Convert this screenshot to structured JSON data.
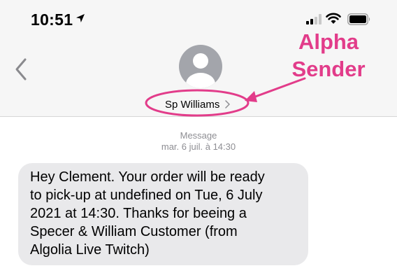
{
  "status_bar": {
    "time": "10:51"
  },
  "header": {
    "contact_name": "Sp Williams"
  },
  "annotation": {
    "label_line1": "Alpha",
    "label_line2": "Sender",
    "color": "#e23c8a"
  },
  "thread": {
    "service": "Message",
    "timestamp": "mar. 6 juil. à 14:30",
    "messages": [
      {
        "direction": "incoming",
        "lines": [
          "Hey Clement. Your order will be ready",
          "to pick-up at undefined on Tue, 6 July",
          "2021 at 14:30. Thanks for beeing a",
          "Specer & William Customer (from",
          "Algolia Live Twitch)"
        ]
      }
    ]
  },
  "icons": [
    "location-arrow-icon",
    "signal-icon",
    "wifi-icon",
    "battery-icon",
    "back-chevron-icon",
    "avatar-icon",
    "chevron-right-icon"
  ]
}
